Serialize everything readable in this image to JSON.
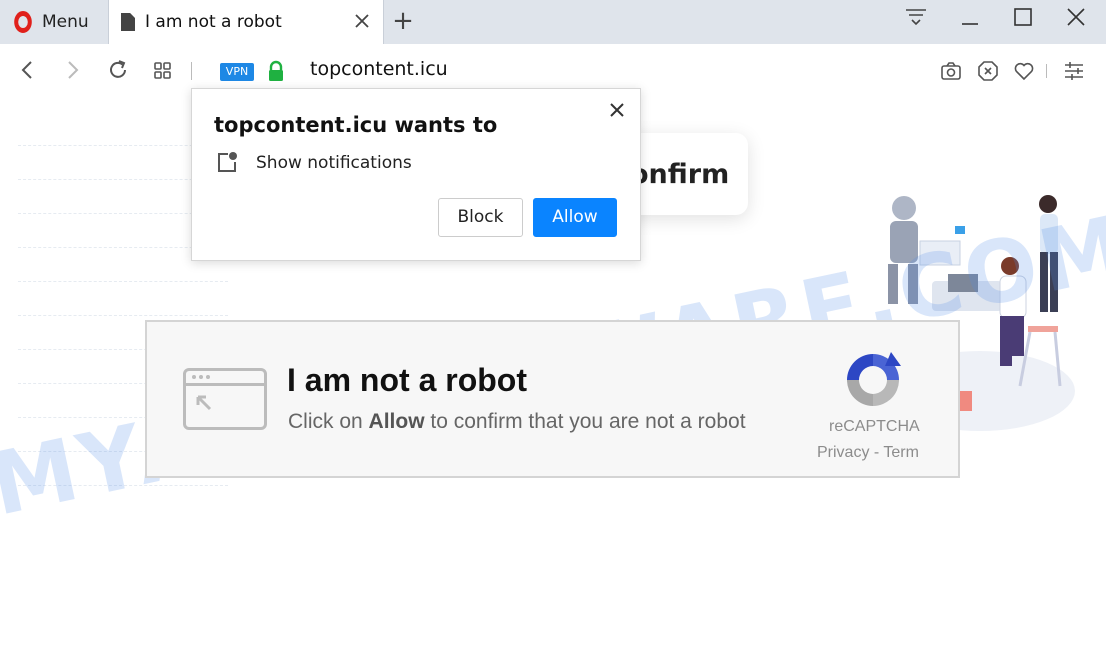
{
  "browser": {
    "menu_label": "Menu",
    "tab_title": "I am not a robot",
    "new_tab_symbol": "+",
    "vpn_badge": "VPN",
    "url": "topcontent.icu"
  },
  "notification_prompt": {
    "title": "topcontent.icu wants to",
    "permission": "Show notifications",
    "block_label": "Block",
    "allow_label": "Allow",
    "close_symbol": "✕"
  },
  "page": {
    "confirm_fragment": "onfirm",
    "watermark": "MYANTISPYWARE.COM",
    "captcha": {
      "title": "I am not a robot",
      "subtitle_prefix": "Click on ",
      "subtitle_bold": "Allow",
      "subtitle_suffix": " to confirm that you are not a robot",
      "brand": "reCAPTCHA",
      "links": "Privacy - Term"
    }
  },
  "colors": {
    "allow_button": "#0a84ff",
    "vpn_badge": "#1e88e5",
    "lock": "#1fb141",
    "opera_red": "#e0201b"
  }
}
